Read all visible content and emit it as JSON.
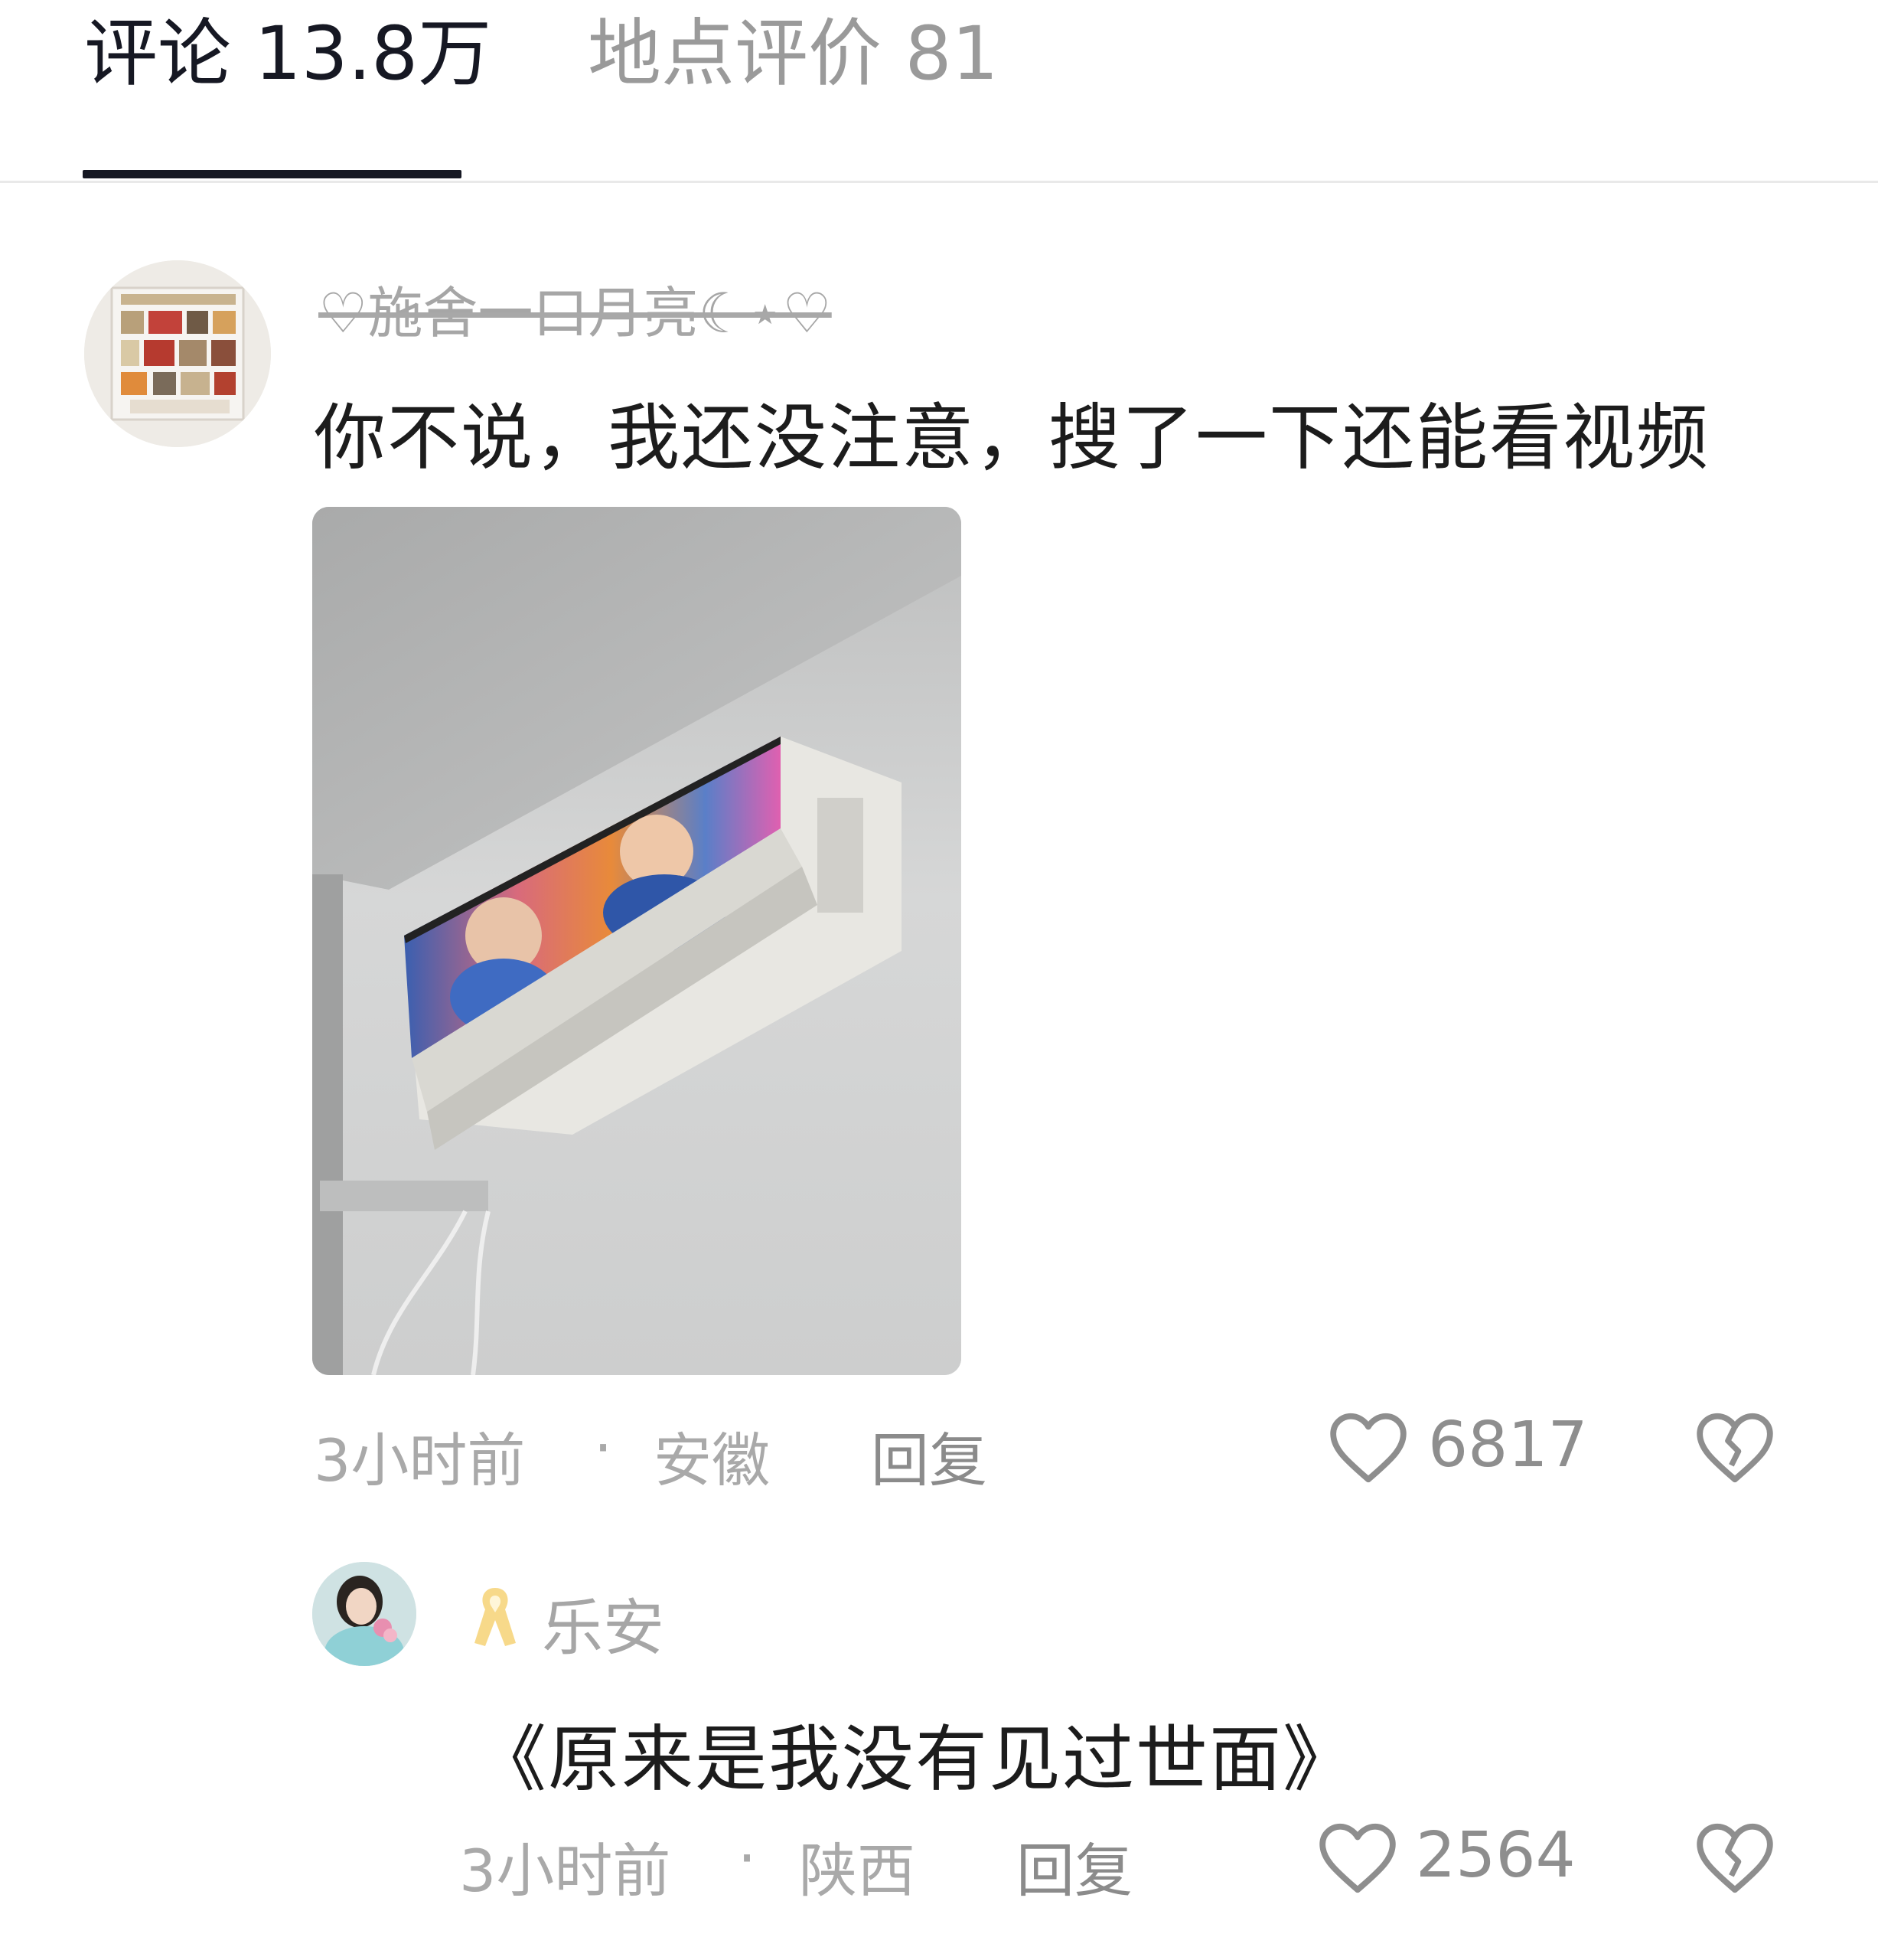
{
  "tabs": [
    {
      "label": "评论 13.8万",
      "active": true
    },
    {
      "label": "地点评价 81",
      "active": false
    }
  ],
  "comment": {
    "username": "♡施舍一口月亮☾⋆♡",
    "text": "你不说，我还没注意，搜了一下还能看视频",
    "time": "3小时前",
    "separator": "·",
    "location": "安徽",
    "reply_label": "回复",
    "likes": "6817"
  },
  "reply": {
    "username": "乐安",
    "text": "《原来是我没有见过世面》",
    "time": "3小时前",
    "separator": "·",
    "location": "陕西",
    "reply_label": "回复",
    "likes": "2564"
  },
  "colors": {
    "active_tab": "#161823",
    "inactive_text": "#9a9a9a",
    "ribbon": "#f7d98a"
  },
  "icons": {
    "like": "heart-outline-icon",
    "dislike": "broken-heart-icon",
    "badge": "yellow-ribbon-icon"
  }
}
